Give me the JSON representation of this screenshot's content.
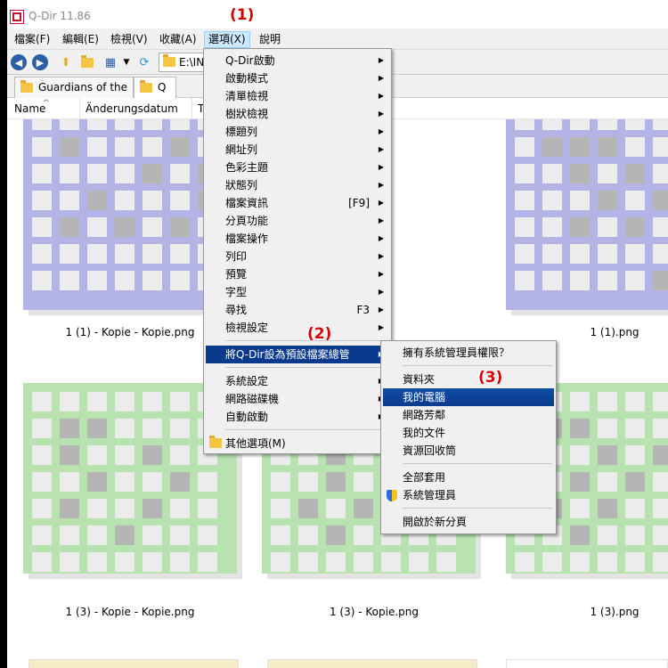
{
  "window": {
    "title": "Q-Dir 11.86"
  },
  "menubar": [
    {
      "label": "檔案(F)"
    },
    {
      "label": "編輯(E)"
    },
    {
      "label": "檢視(V)"
    },
    {
      "label": "收藏(A)"
    },
    {
      "label": "選項(X)"
    },
    {
      "label": "說明"
    }
  ],
  "toolbar": {
    "address": "E:\\INI"
  },
  "tabs": [
    {
      "label": "Guardians of the ..."
    },
    {
      "label": "Q"
    }
  ],
  "columns": [
    {
      "label": "Name"
    },
    {
      "label": "Änderungsdatum"
    },
    {
      "label": "T"
    }
  ],
  "files": [
    {
      "name": "1 (1) - Kopie - Kopie.png",
      "color": "#b3b3e6"
    },
    {
      "name": "1 (1).png",
      "color": "#b3b3e6"
    },
    {
      "name": "1 (3) - Kopie - Kopie.png",
      "color": "#b8e3b1"
    },
    {
      "name": "1 (3) - Kopie.png",
      "color": "#b8e3b1"
    },
    {
      "name": "1 (3).png",
      "color": "#b8e3b1"
    }
  ],
  "options_menu": {
    "items": [
      {
        "label": "Q-Dir啟動",
        "submenu": true
      },
      {
        "label": "啟動模式",
        "submenu": true
      },
      {
        "label": "清單檢視",
        "submenu": true
      },
      {
        "label": "樹狀檢視",
        "submenu": true
      },
      {
        "label": "標題列",
        "submenu": true
      },
      {
        "label": "網址列",
        "submenu": true
      },
      {
        "label": "色彩主題",
        "submenu": true
      },
      {
        "label": "狀態列",
        "submenu": true
      },
      {
        "label": "檔案資訊",
        "shortcut": "[F9]",
        "submenu": true
      },
      {
        "label": "分頁功能",
        "submenu": true
      },
      {
        "label": "檔案操作",
        "submenu": true
      },
      {
        "label": "列印",
        "submenu": true
      },
      {
        "label": "預覽",
        "submenu": true
      },
      {
        "label": "字型",
        "submenu": true
      },
      {
        "label": "尋找",
        "shortcut": "F3",
        "submenu": true
      },
      {
        "label": "檢視設定",
        "submenu": true
      },
      {
        "label": "將Q-Dir設為預設檔案總管",
        "submenu": true,
        "highlighted": true
      },
      {
        "label": "系統設定",
        "submenu": true
      },
      {
        "label": "網路磁碟機",
        "submenu": true
      },
      {
        "label": "自動啟動",
        "submenu": true
      },
      {
        "label": "其他選項(M)"
      }
    ]
  },
  "default_explorer_submenu": {
    "items": [
      {
        "label": "擁有系統管理員權限？"
      },
      {
        "label": "資料夾"
      },
      {
        "label": "我的電腦",
        "highlighted": true
      },
      {
        "label": "網路芳鄰"
      },
      {
        "label": "我的文件"
      },
      {
        "label": "資源回收筒"
      },
      {
        "label": "全部套用"
      },
      {
        "label": "系統管理員"
      },
      {
        "label": "開啟於新分頁"
      }
    ]
  },
  "annotations": [
    "(1)",
    "(2)",
    "(3)"
  ],
  "colors": {
    "highlight": "#0a3a8c",
    "annotation": "#d40000",
    "thumb_bottom_strip": "#f5ecc7"
  }
}
